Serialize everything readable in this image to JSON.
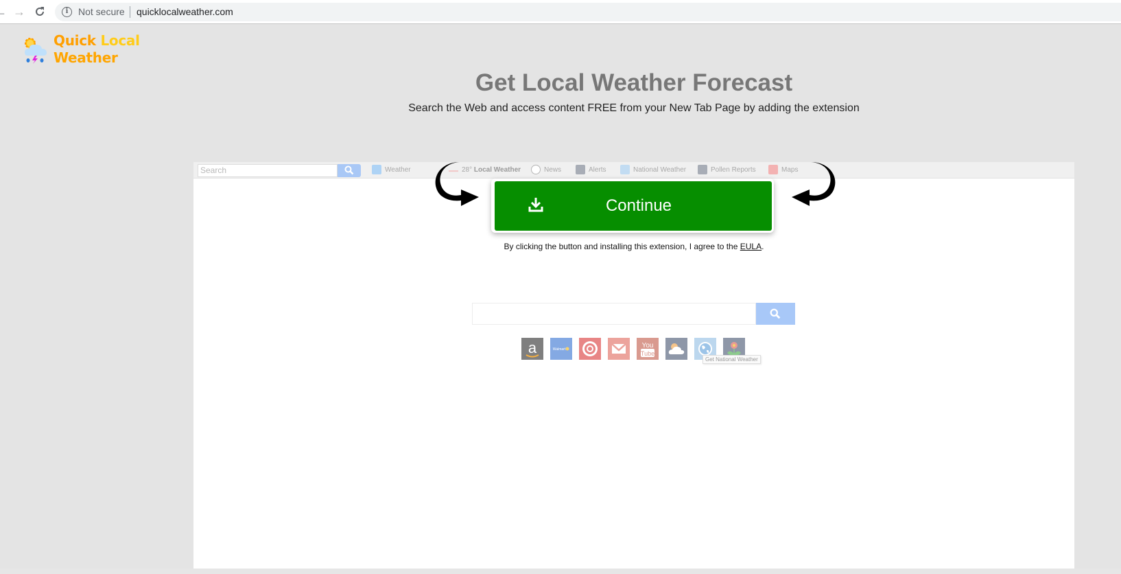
{
  "browser": {
    "security_label": "Not secure",
    "url": "quicklocalweather.com"
  },
  "logo": {
    "word1": "Quick",
    "word2": "Local",
    "word3": "Weather",
    "icon": "weather-storm-icon"
  },
  "hero": {
    "title": "Get Local Weather Forecast",
    "subtitle": "Search the Web and access content FREE from your New Tab Page by adding the extension"
  },
  "preview_toolbar": {
    "search_placeholder": "Search",
    "items": [
      {
        "label": "Weather",
        "icon": "weather-folder-icon"
      },
      {
        "label_prefix": "28°",
        "label": "Local Weather",
        "icon": "sun-icon"
      },
      {
        "label": "News",
        "icon": "news-icon"
      },
      {
        "label": "Alerts",
        "icon": "alerts-cloud-icon"
      },
      {
        "label": "National Weather",
        "icon": "globe-icon"
      },
      {
        "label": "Pollen Reports",
        "icon": "flower-icon"
      },
      {
        "label": "Maps",
        "icon": "map-pin-icon"
      }
    ]
  },
  "cta": {
    "button_label": "Continue",
    "eula_prefix": "By clicking the button and installing this extension, I agree to the ",
    "eula_link": "EULA",
    "eula_suffix": "."
  },
  "quick_links": [
    {
      "name": "Amazon",
      "color": "#7f7f7f"
    },
    {
      "name": "Walmart",
      "color": "#84a9e3"
    },
    {
      "name": "Target",
      "color": "#e88585"
    },
    {
      "name": "Mail",
      "color": "#eca39c"
    },
    {
      "name": "YouTube",
      "color": "#d99a8f"
    },
    {
      "name": "Weather",
      "color": "#8e97a8"
    },
    {
      "name": "National Weather",
      "color": "#bcd7ee"
    },
    {
      "name": "Pollen",
      "color": "#8e97a8"
    }
  ],
  "tooltip": "Get National Weather",
  "colors": {
    "cta_green": "#068e00",
    "page_bg": "#e4e4e4",
    "logo_orange": "#ff9f00",
    "logo_yellow": "#ffcc1a"
  }
}
